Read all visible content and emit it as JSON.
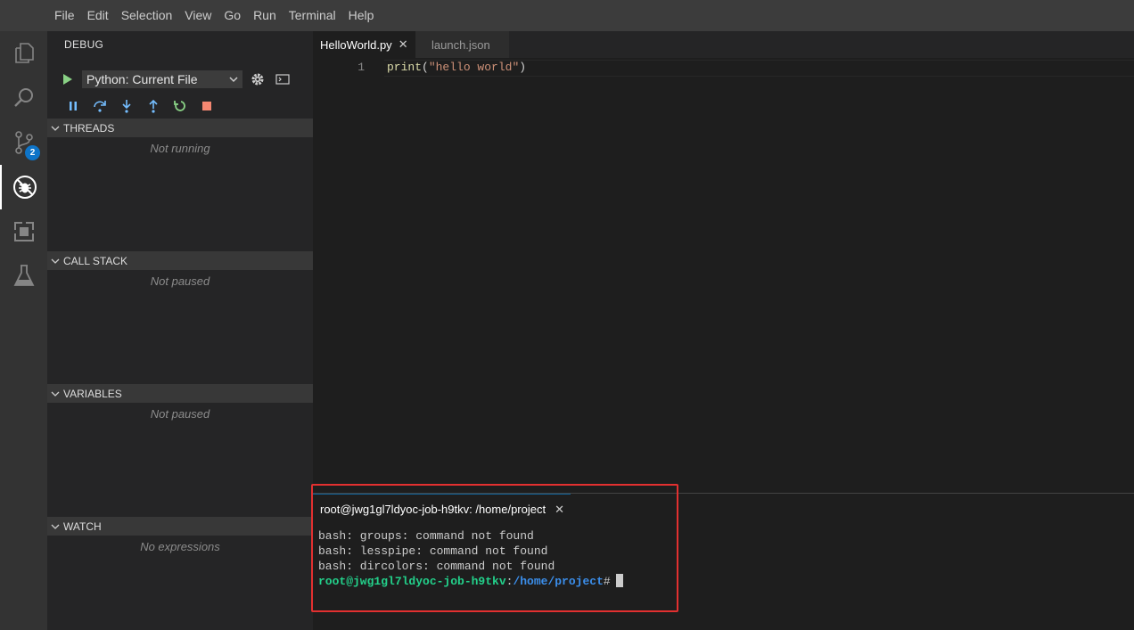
{
  "menu": [
    "File",
    "Edit",
    "Selection",
    "View",
    "Go",
    "Run",
    "Terminal",
    "Help"
  ],
  "activity": {
    "scm_badge": "2"
  },
  "sidebar": {
    "title": "DEBUG",
    "config_selected": "Python: Current File",
    "sections": [
      {
        "title": "THREADS",
        "message": "Not running"
      },
      {
        "title": "CALL STACK",
        "message": "Not paused"
      },
      {
        "title": "VARIABLES",
        "message": "Not paused"
      },
      {
        "title": "WATCH",
        "message": "No expressions"
      }
    ]
  },
  "editor": {
    "tabs": [
      {
        "label": "HelloWorld.py",
        "active": true
      },
      {
        "label": "launch.json",
        "active": false
      }
    ],
    "line_number": "1",
    "code": {
      "fn": "print",
      "open": "(",
      "str": "\"hello world\"",
      "close": ")"
    }
  },
  "terminal": {
    "tab_title": "root@jwg1gl7ldyoc-job-h9tkv: /home/project",
    "lines": [
      "bash: groups: command not found",
      "bash: lesspipe: command not found",
      "bash: dircolors: command not found"
    ],
    "prompt_user": "root@jwg1gl7ldyoc-job-h9tkv",
    "prompt_sep": ":",
    "prompt_path": "/home/project",
    "prompt_suffix": "#"
  },
  "colors": {
    "accent": "#0e74c8",
    "highlight_box": "#e23030",
    "prompt_user": "#23d18b",
    "prompt_path": "#3b8eea"
  }
}
